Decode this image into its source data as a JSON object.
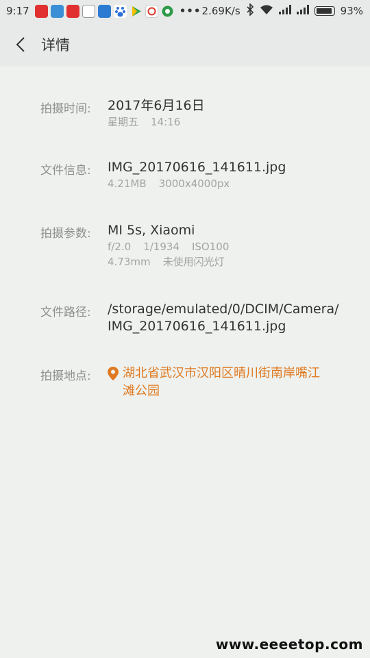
{
  "status_bar": {
    "time": "9:17",
    "speed": "2.69K/s",
    "battery": "93%",
    "battery_level": 0.93,
    "app_icons": [
      {
        "name": "red-app-icon",
        "color": "#e03030"
      },
      {
        "name": "blue-app-icon",
        "color": "#3a8fd6"
      },
      {
        "name": "red-app-icon-2",
        "color": "#e03030"
      },
      {
        "name": "news-app-icon",
        "color": "#444444"
      },
      {
        "name": "weather-app-icon",
        "color": "#2b7bd3"
      },
      {
        "name": "baidu-app-icon",
        "color": "#2c6fdc"
      },
      {
        "name": "play-store-icon",
        "color": "#34a853"
      },
      {
        "name": "cctv-app-icon",
        "color": "#d93b2b"
      },
      {
        "name": "browser-app-icon",
        "color": "#2f9a48"
      }
    ]
  },
  "header": {
    "title": "详情"
  },
  "details": {
    "time": {
      "label": "拍摄时间:",
      "value": "2017年6月16日",
      "weekday": "星期五",
      "clock": "14:16"
    },
    "file_info": {
      "label": "文件信息:",
      "value": "IMG_20170616_141611.jpg",
      "size": "4.21MB",
      "resolution": "3000x4000px"
    },
    "params": {
      "label": "拍摄参数:",
      "value": "MI 5s, Xiaomi",
      "aperture": "f/2.0",
      "shutter": "1/1934",
      "iso": "ISO100",
      "focal": "4.73mm",
      "flash": "未使用闪光灯"
    },
    "path": {
      "label": "文件路径:",
      "line1": "/storage/emulated/0/DCIM/Camera/",
      "line2": "IMG_20170616_141611.jpg"
    },
    "location": {
      "label": "拍摄地点:",
      "value": "湖北省武汉市汉阳区晴川街南岸嘴江滩公园",
      "color": "#e07a22"
    }
  },
  "watermark": "www.eeeetop.com"
}
